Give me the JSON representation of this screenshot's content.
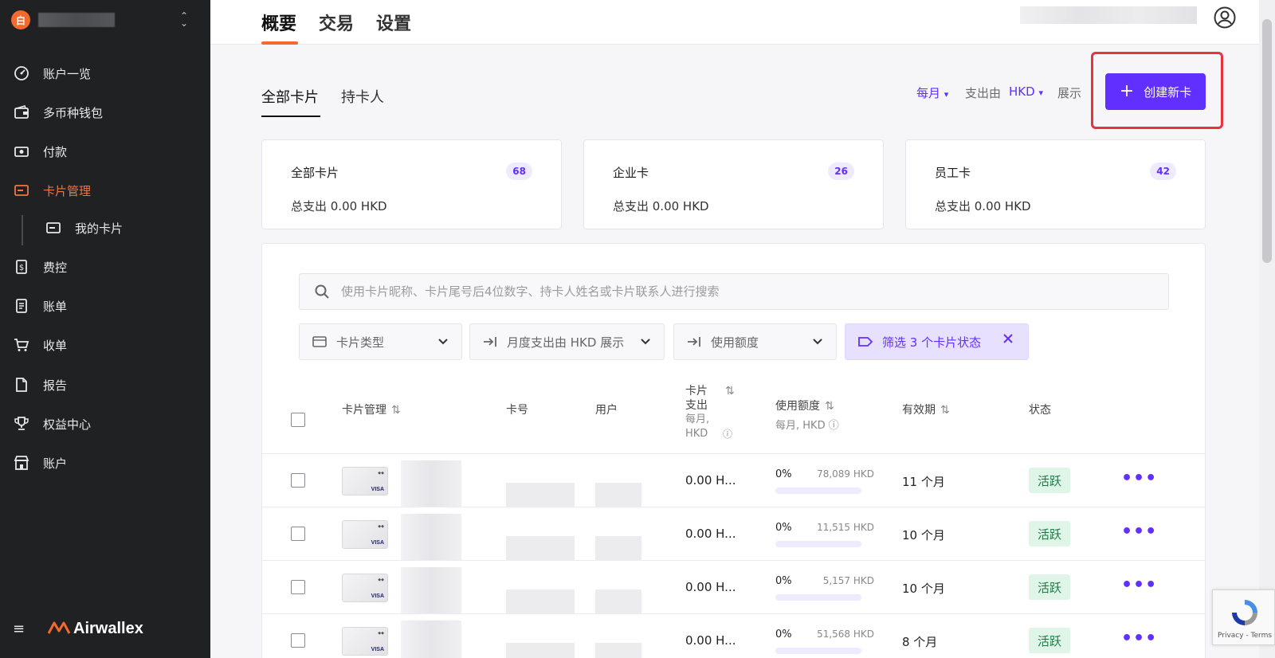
{
  "sidebar": {
    "workspace_icon_char": "白",
    "items": [
      {
        "label": "账户一览",
        "icon": "dashboard-icon"
      },
      {
        "label": "多币种钱包",
        "icon": "wallet-icon"
      },
      {
        "label": "付款",
        "icon": "payments-icon"
      },
      {
        "label": "卡片管理",
        "icon": "card-icon"
      },
      {
        "label": "我的卡片",
        "icon": "my-card-icon"
      },
      {
        "label": "费控",
        "icon": "expense-icon"
      },
      {
        "label": "账单",
        "icon": "bill-icon"
      },
      {
        "label": "收单",
        "icon": "cart-icon"
      },
      {
        "label": "报告",
        "icon": "report-icon"
      },
      {
        "label": "权益中心",
        "icon": "trophy-icon"
      },
      {
        "label": "账户",
        "icon": "store-icon"
      }
    ],
    "active_item": "卡片管理",
    "brand": "Airwallex"
  },
  "header": {
    "tabs": [
      "概要",
      "交易",
      "设置"
    ],
    "active_tab": "概要"
  },
  "subtabs": [
    "全部卡片",
    "持卡人"
  ],
  "toolbar": {
    "period": "每月",
    "spend_by": "支出由",
    "currency": "HKD",
    "display": "展示",
    "create_button": "创建新卡"
  },
  "stats": [
    {
      "title": "全部卡片",
      "count": "68",
      "total": "总支出 0.00 HKD"
    },
    {
      "title": "企业卡",
      "count": "26",
      "total": "总支出 0.00 HKD"
    },
    {
      "title": "员工卡",
      "count": "42",
      "total": "总支出 0.00 HKD"
    }
  ],
  "search": {
    "placeholder": "使用卡片昵称、卡片尾号后4位数字、持卡人姓名或卡片联系人进行搜索"
  },
  "filters": {
    "card_type": "卡片类型",
    "monthly_spend": "月度支出由 HKD 展示",
    "usage_limit": "使用额度",
    "status_filter": "筛选 3 个卡片状态"
  },
  "table": {
    "headers": {
      "card": "卡片管理",
      "number": "卡号",
      "user": "用户",
      "spend_line1": "卡片",
      "spend_line2": "支出",
      "spend_sub1": "每月,",
      "spend_sub2": "HKD",
      "limit": "使用额度",
      "limit_sub": "每月, HKD",
      "expiry": "有效期",
      "status": "状态"
    },
    "rows": [
      {
        "spend": "0.00 H...",
        "pct": "0%",
        "limit": "78,089 HKD",
        "expiry": "11 个月",
        "status": "活跃"
      },
      {
        "spend": "0.00 H...",
        "pct": "0%",
        "limit": "11,515 HKD",
        "expiry": "10 个月",
        "status": "活跃"
      },
      {
        "spend": "0.00 H...",
        "pct": "0%",
        "limit": "5,157 HKD",
        "expiry": "10 个月",
        "status": "活跃"
      },
      {
        "spend": "0.00 H...",
        "pct": "0%",
        "limit": "51,568 HKD",
        "expiry": "8 个月",
        "status": "活跃"
      }
    ]
  },
  "recaptcha": {
    "privacy": "Privacy - Terms"
  },
  "colors": {
    "accent": "#612fff",
    "brand_orange": "#f26a2e",
    "sidebar_bg": "#1f2123",
    "highlight": "#e8323c"
  }
}
